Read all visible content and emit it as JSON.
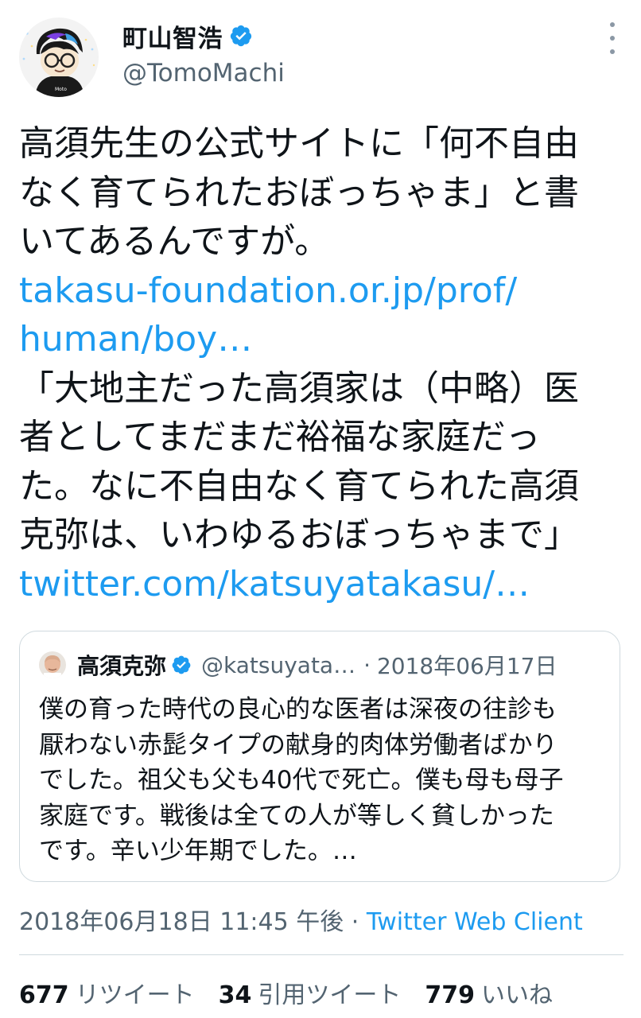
{
  "author": {
    "display_name": "町山智浩",
    "handle": "@TomoMachi",
    "verified": true,
    "avatar_text": "Moto"
  },
  "menu_icon": "more-vertical-icon",
  "tweet_body": {
    "lines": [
      {
        "text": "高須先生の公式サイトに「何不自由",
        "link": false
      },
      {
        "text": "なく育てられたおぼっちゃま」と書",
        "link": false
      },
      {
        "text": "いてあるんですが。",
        "link": false
      },
      {
        "text": "takasu-foundation.or.jp/prof/",
        "link": true
      },
      {
        "text": "human/boy…",
        "link": true
      },
      {
        "text": "「大地主だった高須家は（中略）医",
        "link": false
      },
      {
        "text": "者としてまだまだ裕福な家庭だっ",
        "link": false
      },
      {
        "text": "た。なに不自由なく育てられた高須",
        "link": false
      },
      {
        "text": "克弥は、いわゆるおぼっちゃまで」",
        "link": false
      },
      {
        "text": "twitter.com/katsuyatakasu/…",
        "link": true
      }
    ]
  },
  "quote": {
    "display_name": "高須克弥",
    "verified": true,
    "handle": "@katsuyata…",
    "separator": "·",
    "date": "2018年06月17日",
    "lines": [
      "僕の育った時代の良心的な医者は深夜の往診も",
      "厭わない赤髭タイプの献身的肉体労働者ばかり",
      "でした。祖父も父も40代で死亡。僕も母も母子",
      "家庭です。戦後は全ての人が等しく貧しかった",
      "です。辛い少年期でした。…"
    ]
  },
  "meta": {
    "timestamp": "2018年06月18日 11:45 午後",
    "separator": "·",
    "client": "Twitter Web Client"
  },
  "stats": [
    {
      "count": "677",
      "label": "リツイート"
    },
    {
      "count": "34",
      "label": "引用ツイート"
    },
    {
      "count": "779",
      "label": "いいね"
    }
  ],
  "colors": {
    "link": "#1d9bf0",
    "verified": "#1d9bf0",
    "secondary_text": "#536471",
    "border": "#cfd9de"
  }
}
